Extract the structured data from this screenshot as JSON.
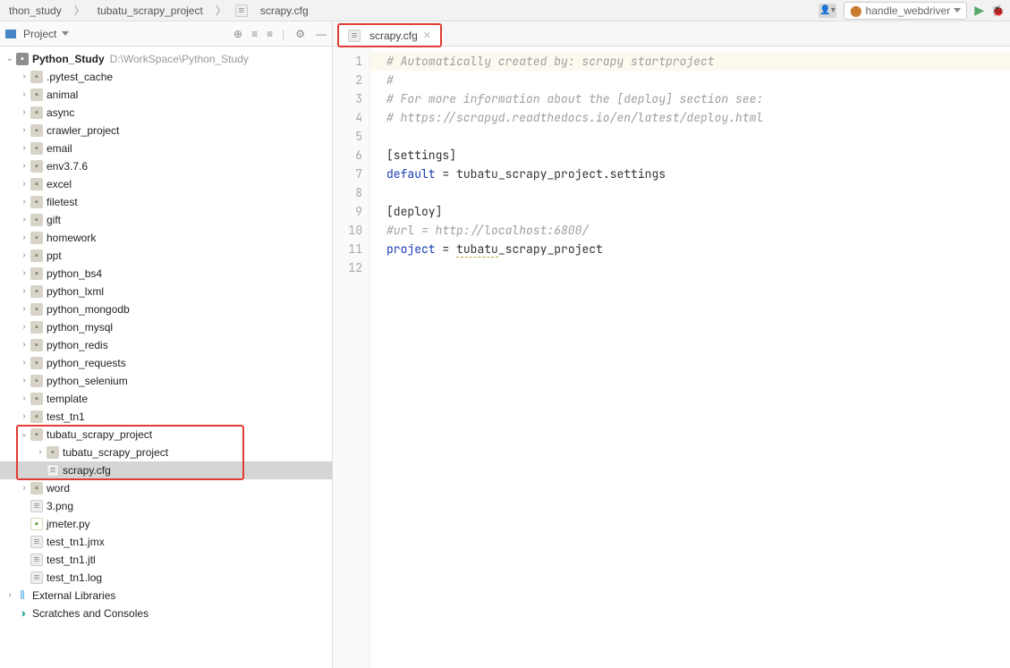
{
  "breadcrumb": [
    "thon_study",
    "tubatu_scrapy_project",
    "scrapy.cfg"
  ],
  "run_config": "handle_webdriver",
  "panel_title": "Project",
  "project_root_name": "Python_Study",
  "project_root_path": "D:\\WorkSpace\\Python_Study",
  "tree": [
    {
      "label": ".pytest_cache",
      "type": "folder",
      "expandable": true
    },
    {
      "label": "animal",
      "type": "folder",
      "expandable": true
    },
    {
      "label": "async",
      "type": "folder",
      "expandable": true
    },
    {
      "label": "crawler_project",
      "type": "folder",
      "expandable": true
    },
    {
      "label": "email",
      "type": "folder",
      "expandable": true
    },
    {
      "label": "env3.7.6",
      "type": "folder",
      "expandable": true
    },
    {
      "label": "excel",
      "type": "folder",
      "expandable": true
    },
    {
      "label": "filetest",
      "type": "folder",
      "expandable": true
    },
    {
      "label": "gift",
      "type": "folder",
      "expandable": true
    },
    {
      "label": "homework",
      "type": "folder",
      "expandable": true
    },
    {
      "label": "ppt",
      "type": "folder",
      "expandable": true
    },
    {
      "label": "python_bs4",
      "type": "folder",
      "expandable": true
    },
    {
      "label": "python_lxml",
      "type": "folder",
      "expandable": true
    },
    {
      "label": "python_mongodb",
      "type": "folder",
      "expandable": true
    },
    {
      "label": "python_mysql",
      "type": "folder",
      "expandable": true
    },
    {
      "label": "python_redis",
      "type": "folder",
      "expandable": true
    },
    {
      "label": "python_requests",
      "type": "folder",
      "expandable": true
    },
    {
      "label": "python_selenium",
      "type": "folder",
      "expandable": true
    },
    {
      "label": "template",
      "type": "folder",
      "expandable": true
    },
    {
      "label": "test_tn1",
      "type": "folder",
      "expandable": true
    }
  ],
  "highlighted_folder": "tubatu_scrapy_project",
  "highlighted_subfolder": "tubatu_scrapy_project",
  "highlighted_file": "scrapy.cfg",
  "after_tree": [
    {
      "label": "word",
      "type": "folder",
      "expandable": true,
      "icon": "folder"
    },
    {
      "label": "3.png",
      "type": "file",
      "expandable": false,
      "icon": "file"
    },
    {
      "label": "jmeter.py",
      "type": "file",
      "expandable": false,
      "icon": "py"
    },
    {
      "label": "test_tn1.jmx",
      "type": "file",
      "expandable": false,
      "icon": "file"
    },
    {
      "label": "test_tn1.jtl",
      "type": "file",
      "expandable": false,
      "icon": "file"
    },
    {
      "label": "test_tn1.log",
      "type": "file",
      "expandable": false,
      "icon": "file"
    }
  ],
  "external_libraries": "External Libraries",
  "scratches": "Scratches and Consoles",
  "open_tab": "scrapy.cfg",
  "code_lines": [
    {
      "n": 1,
      "type": "comment",
      "text": "# Automatically created by: scrapy startproject"
    },
    {
      "n": 2,
      "type": "comment",
      "text": "#"
    },
    {
      "n": 3,
      "type": "comment",
      "text": "# For more information about the [deploy] section see:"
    },
    {
      "n": 4,
      "type": "comment",
      "text": "# https://scrapyd.readthedocs.io/en/latest/deploy.html"
    },
    {
      "n": 5,
      "type": "blank",
      "text": ""
    },
    {
      "n": 6,
      "type": "section",
      "text": "[settings]"
    },
    {
      "n": 7,
      "type": "kv",
      "key": "default",
      "val": "tubatu_scrapy_project.settings"
    },
    {
      "n": 8,
      "type": "blank",
      "text": ""
    },
    {
      "n": 9,
      "type": "section",
      "text": "[deploy]"
    },
    {
      "n": 10,
      "type": "comment",
      "text": "#url = http://localhost:6800/"
    },
    {
      "n": 11,
      "type": "kv",
      "key": "project",
      "val": "tubatu_scrapy_project",
      "underline_val": "tubatu"
    },
    {
      "n": 12,
      "type": "blank",
      "text": ""
    }
  ]
}
